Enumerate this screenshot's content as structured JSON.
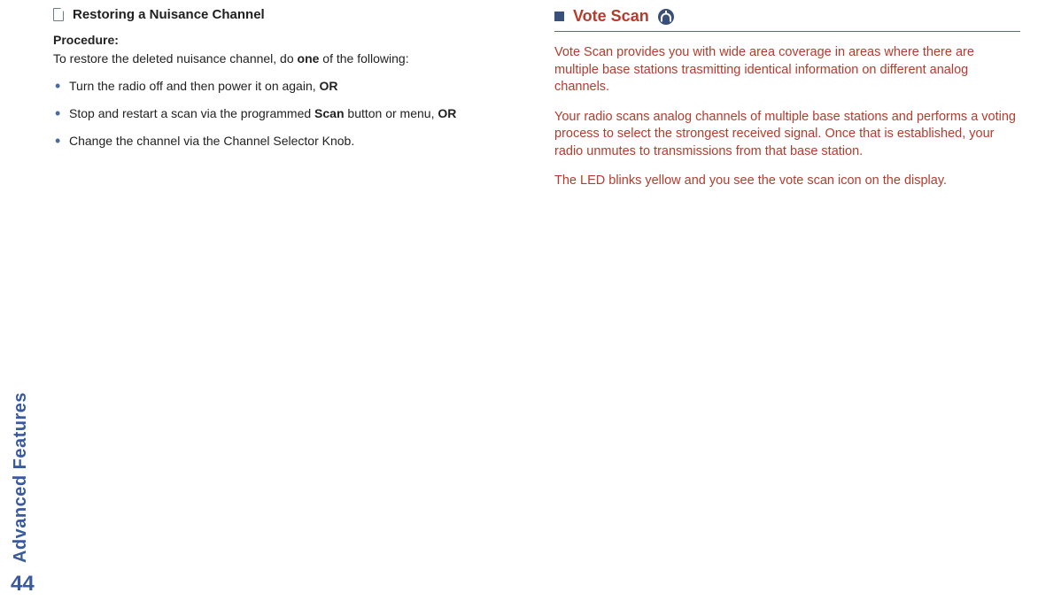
{
  "sidebar": {
    "label": "Advanced Features",
    "page_number": "44"
  },
  "left": {
    "subhead": "Restoring a Nuisance Channel",
    "procedure_label": "Procedure:",
    "intro_pre": "To restore the deleted nuisance channel, do ",
    "intro_bold": "one",
    "intro_post": " of the following:",
    "bullets": [
      {
        "pre": "Turn the radio off and then power it on again, ",
        "bold": "OR",
        "post": ""
      },
      {
        "pre": "Stop and restart a scan via the programmed ",
        "bold": "Scan",
        "mid": " button or menu, ",
        "bold2": "OR",
        "post": ""
      },
      {
        "pre": "Change the channel via the Channel Selector Knob.",
        "bold": "",
        "post": ""
      }
    ]
  },
  "right": {
    "title": "Vote Scan",
    "paras": [
      "Vote Scan provides you with wide area coverage in areas where there are multiple base stations trasmitting identical information on different analog channels.",
      "Your radio scans analog channels of multiple base stations and performs a voting process to select the strongest received signal. Once that is established, your radio unmutes to transmissions from that base station.",
      "The LED blinks yellow and you see the vote scan icon on the display."
    ]
  }
}
